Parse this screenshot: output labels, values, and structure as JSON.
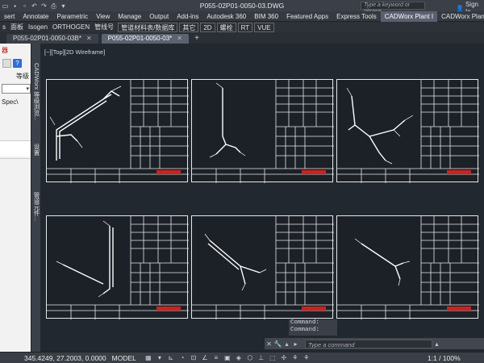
{
  "window": {
    "title": "P055-02P01-0050-03.DWG",
    "search_placeholder": "Type a keyword or phrase",
    "signin": "Sign In"
  },
  "ribbon_tabs": [
    {
      "label": "sert",
      "active": false
    },
    {
      "label": "Annotate",
      "active": false
    },
    {
      "label": "Parametric",
      "active": false
    },
    {
      "label": "View",
      "active": false
    },
    {
      "label": "Manage",
      "active": false
    },
    {
      "label": "Output",
      "active": false
    },
    {
      "label": "Add-ins",
      "active": false
    },
    {
      "label": "Autodesk 360",
      "active": false
    },
    {
      "label": "BIM 360",
      "active": false
    },
    {
      "label": "Featured Apps",
      "active": false
    },
    {
      "label": "Express Tools",
      "active": false
    },
    {
      "label": "CADWorx Plant I",
      "active": true
    },
    {
      "label": "CADWorx Plant II",
      "active": false
    }
  ],
  "ribbon_panels": [
    "s",
    "面板",
    "Isogen",
    "ORTHOGEN",
    "管线号",
    "管道材料表/数据库",
    "其它",
    "2D",
    "螺栓",
    "RT",
    "VUE"
  ],
  "doc_tabs": [
    {
      "label": "P055-02P01-0050-03B*",
      "active": false
    },
    {
      "label": "P055-02P01-0050-03*",
      "active": true
    }
  ],
  "palette": {
    "top_label": "器",
    "grade_label": "等级",
    "spec_text": "Spec\\"
  },
  "side_strip": {
    "labels": [
      "CADWorx 等级浏览...",
      "设置",
      "管道元件..."
    ]
  },
  "viewport": {
    "label": "[−][Top][2D Wireframe]"
  },
  "command": {
    "history": [
      "Command:",
      "Command:"
    ],
    "placeholder": "Type a command"
  },
  "status": {
    "coords": "345.4249, 27.2003, 0.0000",
    "space": "MODEL",
    "scale": "1:1 / 100%"
  },
  "colors": {
    "background": "#212830",
    "sheet_border": "#e8e8e8",
    "title_block_red": "#cc2222"
  }
}
